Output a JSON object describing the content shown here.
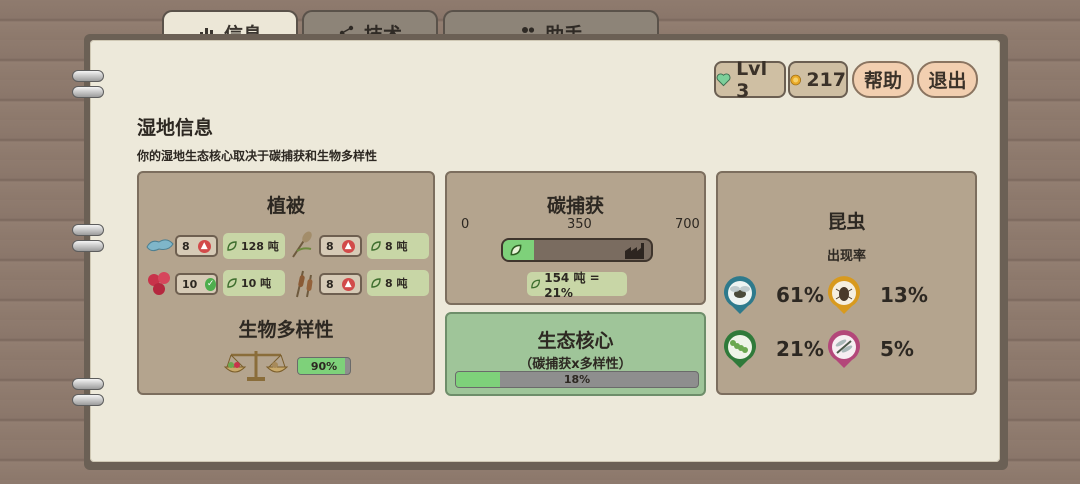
{
  "tabs": [
    {
      "label": "信息",
      "icon": "bar-chart-icon"
    },
    {
      "label": "技术",
      "icon": "nodes-icon"
    },
    {
      "label": "助手",
      "icon": "people-icon"
    }
  ],
  "hud": {
    "level": "Lvl 3",
    "coins": "217",
    "help": "帮助",
    "quit": "退出"
  },
  "page": {
    "title": "湿地信息",
    "subtitle": "你的湿地生态核心取决于碳捕获和生物多样性"
  },
  "vegetation": {
    "title": "植被",
    "items": [
      {
        "icon": "algae-icon",
        "count": "8",
        "status": "up",
        "tons": "128 吨"
      },
      {
        "icon": "reed-plant-icon",
        "count": "8",
        "status": "up",
        "tons": "8 吨"
      },
      {
        "icon": "berries-icon",
        "count": "10",
        "status": "ok",
        "tons": "10 吨"
      },
      {
        "icon": "cattail-icon",
        "count": "8",
        "status": "up",
        "tons": "8 吨"
      }
    ],
    "biodiversity_title": "生物多样性",
    "biodiversity_value": "90%",
    "biodiversity_fraction": 0.9
  },
  "carbon": {
    "title": "碳捕获",
    "ticks": [
      "0",
      "350",
      "700"
    ],
    "value_label": "154 吨 = 21%",
    "fraction": 0.21
  },
  "core": {
    "title": "生态核心",
    "subtitle": "（碳捕获x多样性）",
    "value": "18%",
    "fraction": 0.18
  },
  "insects": {
    "title": "昆虫",
    "subtitle": "出现率",
    "items": [
      {
        "icon": "fly-icon",
        "value": "61%",
        "color": "#2e7a8c"
      },
      {
        "icon": "beetle-icon",
        "value": "13%",
        "color": "#d89a1e"
      },
      {
        "icon": "caterpillar-icon",
        "value": "21%",
        "color": "#2f7a3a"
      },
      {
        "icon": "dragonfly-icon",
        "value": "5%",
        "color": "#b3477a"
      }
    ]
  }
}
